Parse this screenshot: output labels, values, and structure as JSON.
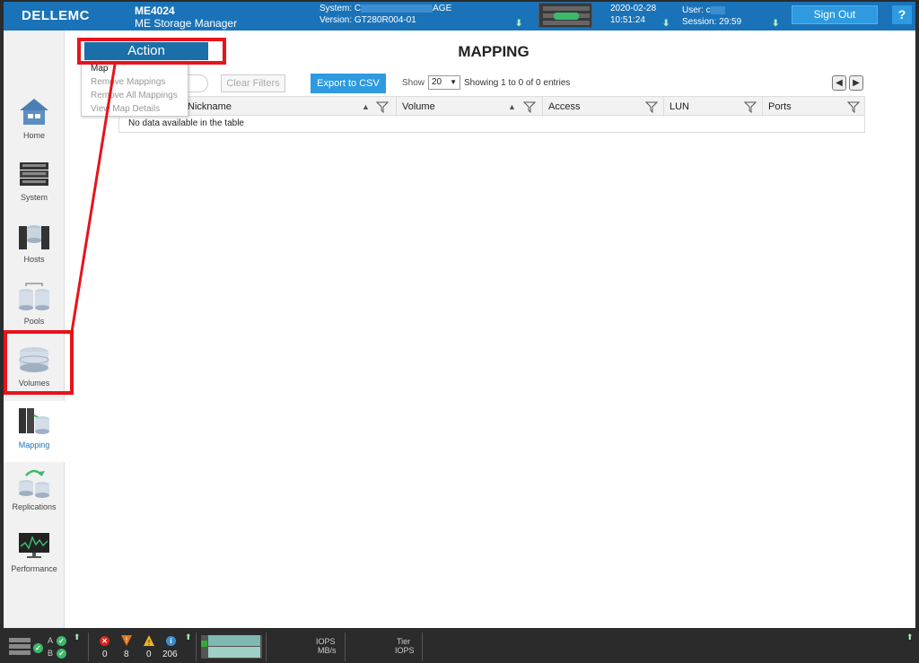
{
  "header": {
    "brand": "DELLEMC",
    "model": "ME4024",
    "product": "ME Storage Manager",
    "system_label": "System: C",
    "system_suffix": "AGE",
    "version": "Version: GT280R004-01",
    "date": "2020-02-28",
    "time": "10:51:24",
    "user_label": "User: c",
    "session": "Session: 29:59",
    "sign_out": "Sign Out",
    "help": "?"
  },
  "sidebar": {
    "items": [
      {
        "label": "Home",
        "icon": "home-icon"
      },
      {
        "label": "System",
        "icon": "system-icon"
      },
      {
        "label": "Hosts",
        "icon": "hosts-icon"
      },
      {
        "label": "Pools",
        "icon": "pools-icon"
      },
      {
        "label": "Volumes",
        "icon": "volumes-icon"
      },
      {
        "label": "Mapping",
        "icon": "mapping-icon"
      },
      {
        "label": "Replications",
        "icon": "replications-icon"
      },
      {
        "label": "Performance",
        "icon": "performance-icon"
      }
    ],
    "active": "Mapping"
  },
  "main": {
    "title": "MAPPING",
    "action_label": "Action",
    "action_menu": [
      "Map",
      "Remove Mappings",
      "Remove All Mappings",
      "View Map Details"
    ],
    "clear_filters": "Clear Filters",
    "export_csv": "Export to CSV",
    "show_label": "Show",
    "show_value": "20",
    "entries": "Showing 1 to 0 of 0 entries",
    "columns": [
      "Nickname",
      "Volume",
      "Access",
      "LUN",
      "Ports"
    ],
    "empty_text": "No data available in the table"
  },
  "statusbar": {
    "controller_a": "A",
    "controller_b": "B",
    "errors": "0",
    "critical": "8",
    "warnings": "0",
    "info": "206",
    "iops": "IOPS",
    "mbs": "MB/s",
    "tier": "Tier",
    "tier_iops": "IOPS"
  },
  "colors": {
    "header_blue": "#1a73b8",
    "accent": "#2e9ae0",
    "highlight_red": "#e8131b"
  }
}
